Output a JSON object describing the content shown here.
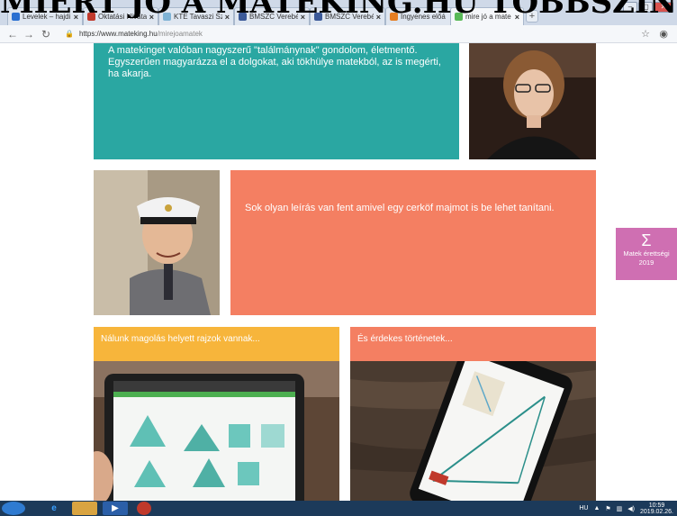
{
  "overlay_heading": "MIÉRT JÓ A MATEKING.HU TÖBBSZINTŰ FELKÉSZÍTÉSE",
  "browser": {
    "tabs": [
      {
        "label": "Levelek – hajdi",
        "fav": "#2a6fd1",
        "active": false
      },
      {
        "label": "Oktatási Hivata",
        "fav": "#c0392b",
        "active": false
      },
      {
        "label": "KTE Tavaszi Sz",
        "fav": "#7fb3d5",
        "active": false
      },
      {
        "label": "BMSZC Verebé",
        "fav": "#3b5998",
        "active": false
      },
      {
        "label": "BMSZC Verebé",
        "fav": "#3b5998",
        "active": false
      },
      {
        "label": "Ingyenes előá",
        "fav": "#e67e22",
        "active": false
      },
      {
        "label": "mire jó a mate",
        "fav": "#59b957",
        "active": true
      }
    ],
    "url_host": "https://www.mateking.hu",
    "url_path": "/mirejoamatek"
  },
  "tiles": {
    "quote_1": "A matekinget valóban nagyszerű \"találmánynak\" gondolom, életmentő. Egyszerűen magyarázza el a dolgokat, aki tökhülye matekból, az is megérti, ha akarja.",
    "quote_2": "Sok olyan leírás van fent amivel egy cerköf majmot is be lehet tanítani.",
    "card_left_title": "Nálunk magolás helyett rajzok vannak...",
    "card_right_title": "És érdekes történetek..."
  },
  "side_badge": {
    "symbol": "Σ",
    "line1": "Matek érettségi",
    "line2": "2019"
  },
  "taskbar": {
    "lang": "HU",
    "time": "10:59",
    "date": "2019.02.26."
  },
  "colors": {
    "teal": "#2aa7a2",
    "salmon": "#f47f62",
    "yellow": "#f7b53b",
    "pink": "#cf6fb2"
  }
}
